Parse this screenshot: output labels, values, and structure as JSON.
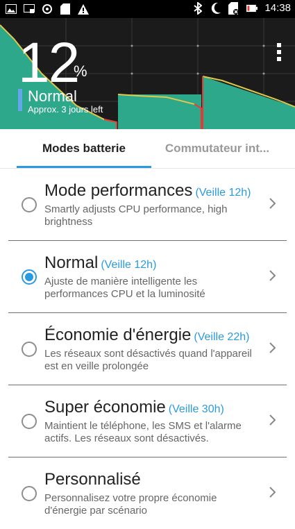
{
  "status_bar": {
    "time": "14:38",
    "left_icons": [
      "image-icon",
      "cast-icon",
      "wifi-assist-icon",
      "sd-card-icon",
      "warning-icon"
    ],
    "right_icons": [
      "bluetooth-icon",
      "moon-icon",
      "no-sim-icon",
      "battery-low-icon"
    ]
  },
  "header": {
    "percent": "12",
    "percent_sign": "%",
    "mode": "Normal",
    "approx": "Approx. 3 jours left",
    "menu_icon": "more-vert-icon"
  },
  "tabs": [
    {
      "label": "Modes batterie",
      "selected": true
    },
    {
      "label": "Commutateur int...",
      "selected": false
    }
  ],
  "modes": [
    {
      "title": "Mode performances",
      "veille": "(Veille 12h)",
      "description": "Smartly adjusts CPU performance, high brightness",
      "selected": false
    },
    {
      "title": "Normal",
      "veille": "(Veille 12h)",
      "description": "Ajuste de manière intelligente les performances CPU et la luminosité",
      "selected": true
    },
    {
      "title": "Économie d'énergie",
      "veille": "(Veille 22h)",
      "description": "Les réseaux sont désactivés quand l'appareil est en veille prolongée",
      "selected": false
    },
    {
      "title": "Super économie",
      "veille": "(Veille 30h)",
      "description": "Maintient le téléphone, les SMS et l'alarme actifs. Les réseaux sont désactivés.",
      "selected": false
    },
    {
      "title": "Personnalisé",
      "veille": "",
      "description": "Personnalisez votre propre économie d'énergie par scénario",
      "selected": false
    }
  ],
  "colors": {
    "accent": "#2a9ae0",
    "graph_fill": "#2ea88a",
    "graph_line": "#d9c24a",
    "graph_low": "#e53935"
  }
}
